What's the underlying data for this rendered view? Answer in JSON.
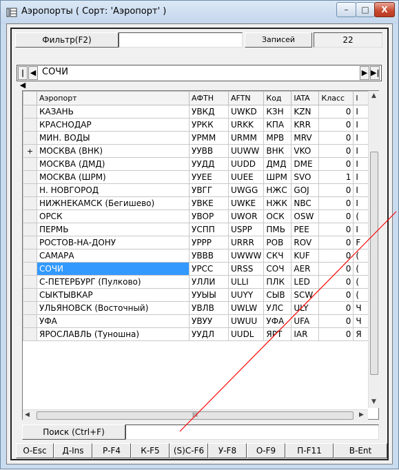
{
  "window": {
    "title": "Аэропорты ( Сорт: 'Аэропорт' )",
    "controls": {
      "minimize": "–",
      "maximize": "□",
      "close": "X"
    }
  },
  "toolbar": {
    "filter_label": "Фильтр(F2)",
    "filter_value": "",
    "records_label": "Записей",
    "records_count": "22"
  },
  "nav": {
    "first": "|◀",
    "prev": "◀",
    "current": "СОЧИ",
    "next": "▶",
    "last": "▶|"
  },
  "grid": {
    "columns": [
      "Аэропорт",
      "АФТН",
      "AFTN",
      "Код",
      "IATA",
      "Класс",
      "I"
    ],
    "rows": [
      {
        "mark": "",
        "name": "КАЗАНЬ",
        "afth": "УВКД",
        "aftn": "UWKD",
        "code": "КЗН",
        "iata": "KZN",
        "klass": "0",
        "i": "I"
      },
      {
        "mark": "",
        "name": "КРАСНОДАР",
        "afth": "УРКК",
        "aftn": "URKK",
        "code": "КПА",
        "iata": "KRR",
        "klass": "0",
        "i": "I"
      },
      {
        "mark": "",
        "name": "МИН. ВОДЫ",
        "afth": "УРММ",
        "aftn": "URMM",
        "code": "МРВ",
        "iata": "MRV",
        "klass": "0",
        "i": "I"
      },
      {
        "mark": "+",
        "name": "МОСКВА (ВНК)",
        "afth": "УУВВ",
        "aftn": "UUWW",
        "code": "ВНК",
        "iata": "VKO",
        "klass": "0",
        "i": "I"
      },
      {
        "mark": "",
        "name": "МОСКВА (ДМД)",
        "afth": "УУДД",
        "aftn": "UUDD",
        "code": "ДМД",
        "iata": "DME",
        "klass": "0",
        "i": "I"
      },
      {
        "mark": "",
        "name": "МОСКВА (ШРМ)",
        "afth": "УУЕЕ",
        "aftn": "UUEE",
        "code": "ШРМ",
        "iata": "SVO",
        "klass": "1",
        "i": "I"
      },
      {
        "mark": "",
        "name": "Н. НОВГОРОД",
        "afth": "УВГГ",
        "aftn": "UWGG",
        "code": "НЖС",
        "iata": "GOJ",
        "klass": "0",
        "i": "I"
      },
      {
        "mark": "",
        "name": "НИЖНЕКАМСК (Бегишево)",
        "afth": "УВКЕ",
        "aftn": "UWKE",
        "code": "НЖК",
        "iata": "NBC",
        "klass": "0",
        "i": "I"
      },
      {
        "mark": "",
        "name": "ОРСК",
        "afth": "УВОР",
        "aftn": "UWOR",
        "code": "ОСК",
        "iata": "OSW",
        "klass": "0",
        "i": "("
      },
      {
        "mark": "",
        "name": "ПЕРМЬ",
        "afth": "УСПП",
        "aftn": "USPP",
        "code": "ПМЬ",
        "iata": "PEE",
        "klass": "0",
        "i": "I"
      },
      {
        "mark": "",
        "name": "РОСТОВ-НА-ДОНУ",
        "afth": "УРРР",
        "aftn": "URRR",
        "code": "РОВ",
        "iata": "ROV",
        "klass": "0",
        "i": "F"
      },
      {
        "mark": "",
        "name": "САМАРА",
        "afth": "УВВВ",
        "aftn": "UWWW",
        "code": "СКЧ",
        "iata": "KUF",
        "klass": "0",
        "i": "("
      },
      {
        "mark": "",
        "name": "СОЧИ",
        "afth": "УРСС",
        "aftn": "URSS",
        "code": "СОЧ",
        "iata": "AER",
        "klass": "0",
        "i": "(",
        "selected": true
      },
      {
        "mark": "",
        "name": "С-ПЕТЕРБУРГ (Пулково)",
        "afth": "УЛЛИ",
        "aftn": "ULLI",
        "code": "ПЛК",
        "iata": "LED",
        "klass": "0",
        "i": "("
      },
      {
        "mark": "",
        "name": "СЫКТЫВКАР",
        "afth": "УУЫЫ",
        "aftn": "UUYY",
        "code": "СЫВ",
        "iata": "SCW",
        "klass": "0",
        "i": "("
      },
      {
        "mark": "",
        "name": "УЛЬЯНОВСК (Восточный)",
        "afth": "УВЛВ",
        "aftn": "UWLW",
        "code": "УЛС",
        "iata": "ULY",
        "klass": "0",
        "i": "Ч"
      },
      {
        "mark": "",
        "name": "УФА",
        "afth": "УВУУ",
        "aftn": "UWUU",
        "code": "УФА",
        "iata": "UFA",
        "klass": "0",
        "i": "Ч"
      },
      {
        "mark": "",
        "name": "ЯРОСЛАВЛЬ (Туношна)",
        "afth": "УУДЛ",
        "aftn": "UUDL",
        "code": "ЯРТ",
        "iata": "IAR",
        "klass": "0",
        "i": "Я"
      }
    ]
  },
  "scroll": {
    "up": "▲",
    "down": "▼",
    "left": "◀",
    "right": "▶",
    "grip": "III"
  },
  "search": {
    "label": "Поиск (Ctrl+F)",
    "value": ""
  },
  "fkeys": [
    "О-Esc",
    "Д-Ins",
    "Р-F4",
    "К-F5",
    "(S)С-F6",
    "У-F8",
    "О-F9",
    "П-F11",
    "В-Ent"
  ],
  "colors": {
    "selection": "#3399ff",
    "annotation_line": "#ff0000"
  }
}
